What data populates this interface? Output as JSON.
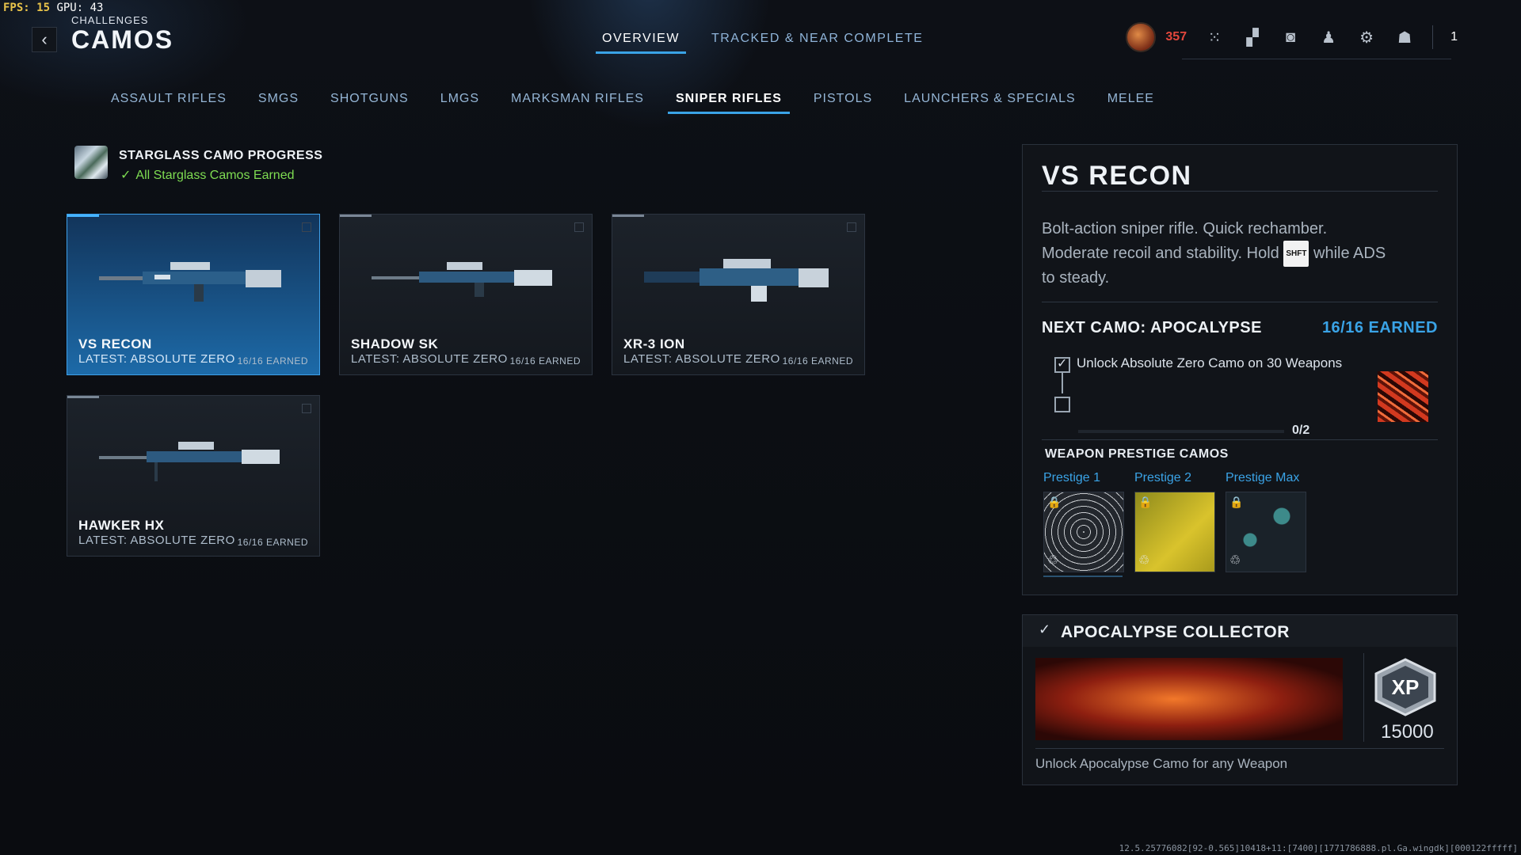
{
  "debug": {
    "fps_label": "FPS:",
    "fps_value": "15",
    "gpu_label": "GPU:",
    "gpu_value": "43"
  },
  "header": {
    "breadcrumb": "CHALLENGES",
    "title": "CAMOS",
    "back_icon": "chevron-left-icon"
  },
  "top_tabs": [
    {
      "label": "OVERVIEW",
      "active": true
    },
    {
      "label": "TRACKED & NEAR COMPLETE",
      "active": false
    }
  ],
  "hud": {
    "currency": "357",
    "party_count": "1",
    "currency_color": "#e2473c"
  },
  "category_tabs": [
    {
      "label": "ASSAULT RIFLES",
      "active": false
    },
    {
      "label": "SMGS",
      "active": false
    },
    {
      "label": "SHOTGUNS",
      "active": false
    },
    {
      "label": "LMGS",
      "active": false
    },
    {
      "label": "MARKSMAN RIFLES",
      "active": false
    },
    {
      "label": "SNIPER RIFLES",
      "active": true
    },
    {
      "label": "PISTOLS",
      "active": false
    },
    {
      "label": "LAUNCHERS & SPECIALS",
      "active": false
    },
    {
      "label": "MELEE",
      "active": false
    }
  ],
  "starglass": {
    "title": "STARGLASS CAMO PROGRESS",
    "status": "All Starglass Camos Earned",
    "status_color": "#7edc52"
  },
  "weapons": [
    {
      "name": "VS RECON",
      "latest": "LATEST: ABSOLUTE ZERO",
      "earned": "16/16 EARNED",
      "selected": true
    },
    {
      "name": "SHADOW SK",
      "latest": "LATEST: ABSOLUTE ZERO",
      "earned": "16/16 EARNED",
      "selected": false
    },
    {
      "name": "XR-3 ION",
      "latest": "LATEST: ABSOLUTE ZERO",
      "earned": "16/16 EARNED",
      "selected": false
    },
    {
      "name": "HAWKER HX",
      "latest": "LATEST: ABSOLUTE ZERO",
      "earned": "16/16 EARNED",
      "selected": false
    }
  ],
  "detail": {
    "name": "VS RECON",
    "desc_line1": "Bolt-action sniper rifle.  Quick rechamber.",
    "desc_line2a": "Moderate recoil and stability.  Hold",
    "desc_key": "SHFT",
    "desc_line2b": "while ADS",
    "desc_line3": "to steady.",
    "next_label": "NEXT CAMO: APOCALYPSE",
    "next_earned": "16/16 EARNED",
    "challenge": "Unlock Absolute Zero Camo on 30 Weapons",
    "challenge_done": true,
    "progress": "0/2",
    "prestige_title": "WEAPON PRESTIGE CAMOS",
    "prestige": [
      {
        "label": "Prestige 1",
        "locked": true
      },
      {
        "label": "Prestige 2",
        "locked": true
      },
      {
        "label": "Prestige Max",
        "locked": true
      }
    ]
  },
  "reward": {
    "title": "APOCALYPSE COLLECTOR",
    "completed": true,
    "xp_label": "XP",
    "xp": "15000",
    "desc": "Unlock Apocalypse Camo for any Weapon"
  },
  "footer": {
    "build": "12.5.25776082[92-0.565]10418+11:[7400][1771786888.pl.Ga.wingdk][000122fffff]"
  }
}
